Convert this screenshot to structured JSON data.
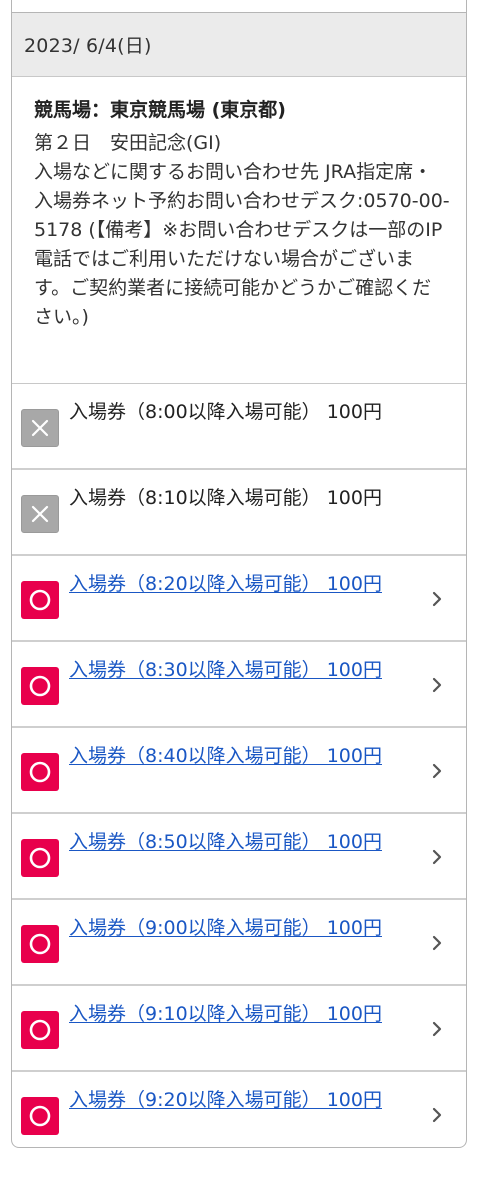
{
  "date_header": "2023/ 6/4(日)",
  "event": {
    "venue": "競馬場：東京競馬場 (東京都)",
    "race": "第２日　安田記念(GⅠ)",
    "contact": "入場などに関するお問い合わせ先 JRA指定席・入場券ネット予約お問い合わせデスク:0570-00-5178 (【備考】※お問い合わせデスクは一部のIP電話ではご利用いただけない場合がございます。ご契約業者に接続可能かどうかご確認ください。)"
  },
  "tickets": [
    {
      "label": "入場券（8:00以降入場可能） 100円",
      "status": "closed",
      "icon": "cross-icon"
    },
    {
      "label": "入場券（8:10以降入場可能） 100円",
      "status": "closed",
      "icon": "cross-icon"
    },
    {
      "label": "入場券（8:20以降入場可能） 100円",
      "status": "open",
      "icon": "circle-icon"
    },
    {
      "label": "入場券（8:30以降入場可能） 100円",
      "status": "open",
      "icon": "circle-icon"
    },
    {
      "label": "入場券（8:40以降入場可能） 100円",
      "status": "open",
      "icon": "circle-icon"
    },
    {
      "label": "入場券（8:50以降入場可能） 100円",
      "status": "open",
      "icon": "circle-icon"
    },
    {
      "label": "入場券（9:00以降入場可能） 100円",
      "status": "open",
      "icon": "circle-icon"
    },
    {
      "label": "入場券（9:10以降入場可能） 100円",
      "status": "open",
      "icon": "circle-icon"
    },
    {
      "label": "入場券（9:20以降入場可能） 100円",
      "status": "open",
      "icon": "circle-icon"
    }
  ],
  "colors": {
    "open_badge": "#e8004c",
    "closed_badge": "#a8a8a8",
    "link": "#1a57c4",
    "header_bg": "#ebebeb"
  }
}
